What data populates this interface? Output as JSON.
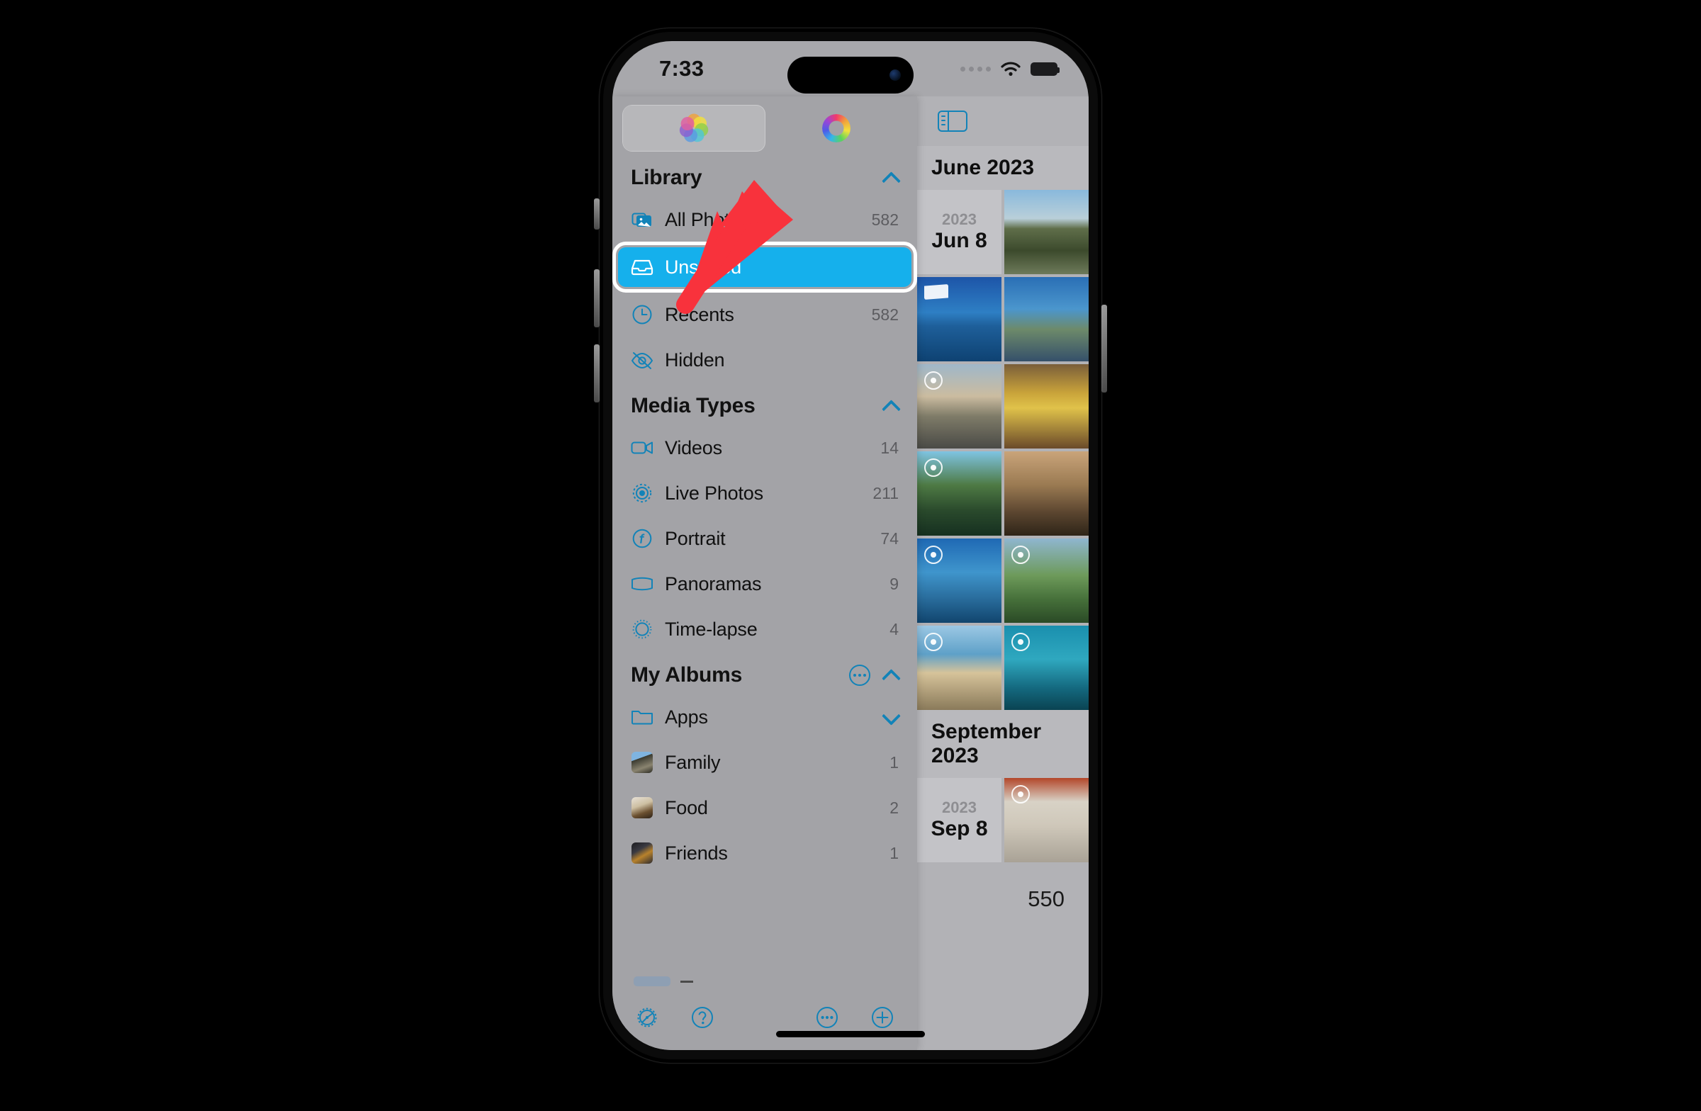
{
  "status_bar": {
    "time": "7:33",
    "icons": [
      "cellular-dots",
      "wifi-icon",
      "battery-icon"
    ]
  },
  "sidebar": {
    "tabs": [
      {
        "name": "photos-tab",
        "icon": "photos-flower-icon",
        "selected": true
      },
      {
        "name": "ring-tab",
        "icon": "rainbow-ring-icon",
        "selected": false
      }
    ],
    "sections": [
      {
        "title": "Library",
        "collapsed": false,
        "has_more_button": false,
        "items": [
          {
            "label": "All Photos",
            "count": "582",
            "icon": "photo-stack-icon",
            "selected": false
          },
          {
            "label": "Unsorted",
            "count": "",
            "icon": "tray-inbox-icon",
            "selected": true
          },
          {
            "label": "Recents",
            "count": "582",
            "icon": "clock-icon",
            "selected": false
          },
          {
            "label": "Hidden",
            "count": "",
            "icon": "eye-slash-icon",
            "selected": false
          }
        ]
      },
      {
        "title": "Media Types",
        "collapsed": false,
        "has_more_button": false,
        "items": [
          {
            "label": "Videos",
            "count": "14",
            "icon": "video-camera-icon",
            "selected": false
          },
          {
            "label": "Live Photos",
            "count": "211",
            "icon": "live-photo-icon",
            "selected": false
          },
          {
            "label": "Portrait",
            "count": "74",
            "icon": "portrait-aperture-icon",
            "selected": false
          },
          {
            "label": "Panoramas",
            "count": "9",
            "icon": "panorama-icon",
            "selected": false
          },
          {
            "label": "Time-lapse",
            "count": "4",
            "icon": "timelapse-icon",
            "selected": false
          }
        ]
      },
      {
        "title": "My Albums",
        "collapsed": false,
        "has_more_button": true,
        "items": [
          {
            "label": "Apps",
            "count": "",
            "icon": "folder-icon",
            "selected": false,
            "expandable": true
          },
          {
            "label": "Family",
            "count": "1",
            "icon": "album-thumbnail",
            "thumb": "th-family",
            "selected": false
          },
          {
            "label": "Food",
            "count": "2",
            "icon": "album-thumbnail",
            "thumb": "th-food",
            "selected": false
          },
          {
            "label": "Friends",
            "count": "1",
            "icon": "album-thumbnail",
            "thumb": "th-friends",
            "selected": false
          }
        ]
      }
    ],
    "toolbar": [
      {
        "name": "settings-gear-button",
        "icon": "gear-icon"
      },
      {
        "name": "help-button",
        "icon": "question-circle-icon"
      },
      {
        "name": "more-options-button",
        "icon": "ellipsis-circle-icon"
      },
      {
        "name": "add-button",
        "icon": "plus-circle-icon"
      }
    ]
  },
  "detail": {
    "sidebar_toggle_icon": "sidebar-toggle-icon",
    "groups": [
      {
        "month": "June 2023",
        "date_year": "2023",
        "date_day": "Jun 8",
        "photos": [
          {
            "class": "ph1",
            "badge": "none"
          },
          {
            "class": "ph2",
            "badge": "panorama"
          },
          {
            "class": "ph3",
            "badge": "none"
          },
          {
            "class": "ph4",
            "badge": "live"
          },
          {
            "class": "ph5",
            "badge": "none"
          },
          {
            "class": "ph6",
            "badge": "live"
          },
          {
            "class": "ph7",
            "badge": "none"
          },
          {
            "class": "ph8",
            "badge": "live"
          },
          {
            "class": "ph9",
            "badge": "none"
          },
          {
            "class": "ph10",
            "badge": "live"
          },
          {
            "class": "ph11",
            "badge": "live"
          }
        ]
      },
      {
        "month": "September 2023",
        "date_year": "2023",
        "date_day": "Sep 8",
        "photos": [
          {
            "class": "ph12",
            "badge": "live"
          }
        ]
      }
    ],
    "count_label": "550"
  },
  "annotation": {
    "arrow_color": "#F8323C",
    "points_to": "Unsorted"
  },
  "colors": {
    "accent_blue": "#1283b8",
    "selection_blue": "#15b0ec",
    "sidebar_bg": "#a3a3a7",
    "detail_bg": "#b2b2b6"
  }
}
